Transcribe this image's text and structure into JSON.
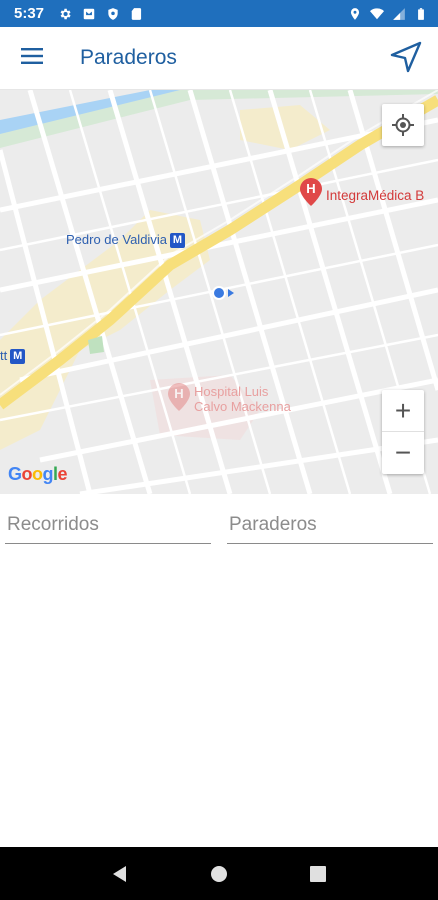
{
  "status_bar": {
    "time": "5:37",
    "left_icons": [
      "settings-icon",
      "notification-box-icon",
      "shield-icon",
      "sd-card-icon"
    ],
    "right_icons": [
      "location-pin-icon",
      "wifi-icon",
      "signal-icon",
      "battery-icon"
    ],
    "background": "#1f6fbd"
  },
  "app_bar": {
    "title": "Paraderos",
    "menu_icon": "hamburger-menu-icon",
    "action_icon": "navigation-arrow-icon",
    "accent": "#1f5fa0"
  },
  "map": {
    "labels": {
      "metro_station": "Pedro de Valdivia",
      "metro_partial": "tt",
      "metro_badge": "M",
      "poi": "IntegraMédica B",
      "hospital_line1": "Hospital Luis",
      "hospital_line2": "Calvo Mackenna",
      "hospital_icon_letter": "H",
      "poi_icon_letter": "H",
      "logo": "Google"
    },
    "controls": {
      "zoom_in": "+",
      "zoom_out": "−",
      "my_location_icon": "my-location-icon"
    }
  },
  "search": {
    "routes_placeholder": "Recorridos",
    "stops_placeholder": "Paraderos"
  },
  "nav_bar": {
    "icons": [
      "back-icon",
      "home-icon",
      "recents-icon"
    ]
  }
}
